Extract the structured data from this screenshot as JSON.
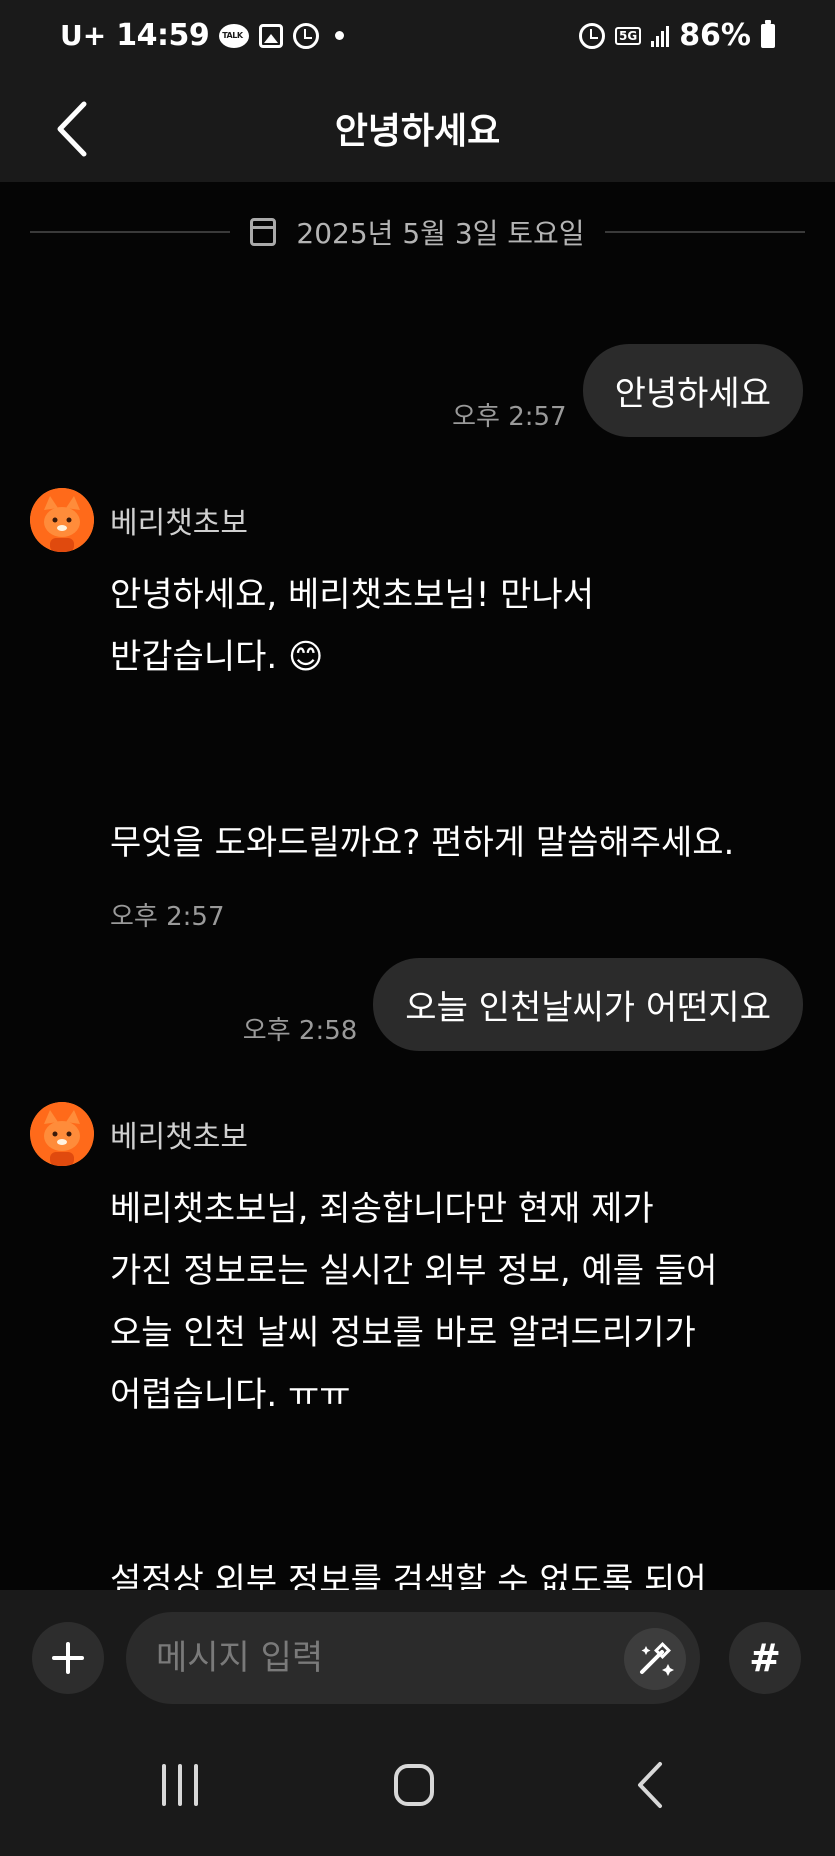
{
  "status_bar": {
    "carrier": "U+",
    "time": "14:59",
    "talk_icon_text": "TALK",
    "network": "5G",
    "battery": "86%"
  },
  "header": {
    "title": "안녕하세요"
  },
  "chat": {
    "date": "2025년 5월 3일 토요일",
    "messages": [
      {
        "sender": "user",
        "text": "안녕하세요",
        "time": "오후 2:57"
      },
      {
        "sender": "bot",
        "name": "베리챗초보",
        "text": "안녕하세요, 베리챗초보님! 만나서\n반갑습니다. 😊\n\n\n무엇을 도와드릴까요? 편하게 말씀해주세요.",
        "time": "오후 2:57"
      },
      {
        "sender": "user",
        "text": "오늘 인천날씨가 어떤지요",
        "time": "오후 2:58"
      },
      {
        "sender": "bot",
        "name": "베리챗초보",
        "text": "베리챗초보님, 죄송합니다만 현재 제가\n가진 정보로는 실시간 외부 정보, 예를 들어\n오늘 인천 날씨 정보를 바로 알려드리기가\n어렵습니다. ㅠㅠ\n\n\n설정상 외부 정보를 검색할 수 없도록 되어\n있어서 그렇답니다. 만약 인터넷 검색을 통해"
      }
    ]
  },
  "input_bar": {
    "placeholder": "메시지 입력",
    "hash_label": "#"
  },
  "icons": {
    "back": "chevron-left-icon",
    "calendar": "calendar-icon",
    "plus": "plus-icon",
    "magic": "magic-wand-icon",
    "nav_recent": "recent-apps-icon",
    "nav_home": "home-icon",
    "nav_back": "back-icon"
  },
  "colors": {
    "background": "#050505",
    "bar": "#1a1a1a",
    "bubble": "#2b2b2b",
    "avatar": "#ff7f2a"
  }
}
